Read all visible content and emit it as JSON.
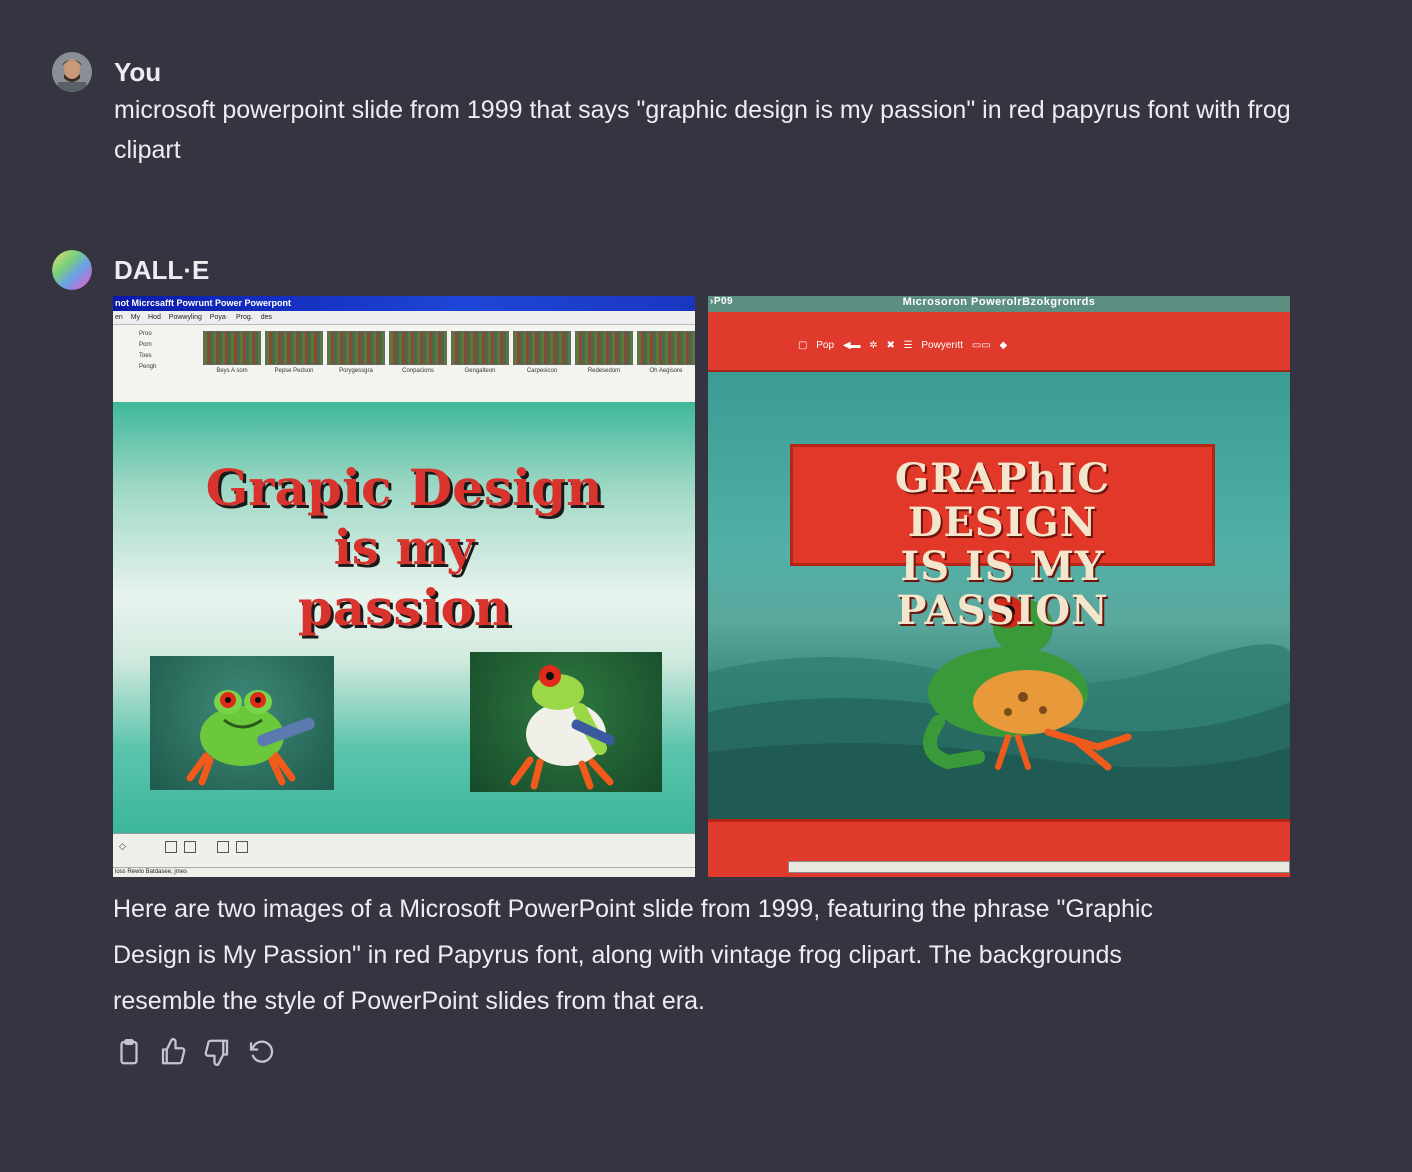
{
  "user": {
    "name": "You",
    "message": "microsoft powerpoint slide from 1999 that says \"graphic design is my passion\" in red papyrus font with frog clipart"
  },
  "assistant": {
    "name": "DALL·E",
    "reply_line1": "Here are two images of a Microsoft PowerPoint slide from 1999, featuring the phrase \"Graphic",
    "reply_line2": "Design is My Passion\" in red Papyrus font, along with vintage frog clipart. The backgrounds",
    "reply_line3": "resemble the style of PowerPoint slides from that era."
  },
  "image1": {
    "titlebar": "not Micrcsafft Powrunt   Power Powerpont",
    "menubar": "en  My  Hod  Powwyling  Poya·  Prog.  des",
    "side_labels": [
      "Proo",
      "Porn",
      "Toes",
      "Pengh"
    ],
    "thumb_labels": [
      "Beys A som",
      "Pepse Pedson",
      "Porygessgra",
      "Conpacions",
      "Gengalteon",
      "Carpesicon",
      "Redesedom",
      "Oh Aegisore"
    ],
    "slide_line1": "Grapic Design",
    "slide_line2": "is my",
    "slide_line3": "passion",
    "status_text": "loss  Rewlo Batdasee, jmes"
  },
  "image2": {
    "top_left": "›P09",
    "top_title": "Mıcrosoron PowerolrBzokgronrds",
    "toolbar_label1": "Pop",
    "toolbar_label2": "Powyerıtt",
    "title_line1": "GRAPhIC DESIGN",
    "title_line2": "IS IS MY PASSION"
  },
  "actions": [
    "copy-icon",
    "thumbs-up-icon",
    "thumbs-down-icon",
    "regenerate-icon"
  ],
  "colors": {
    "background": "#343541",
    "text": "#ececf1",
    "icon": "#c5c5d2",
    "slide_red": "#d8332c"
  }
}
